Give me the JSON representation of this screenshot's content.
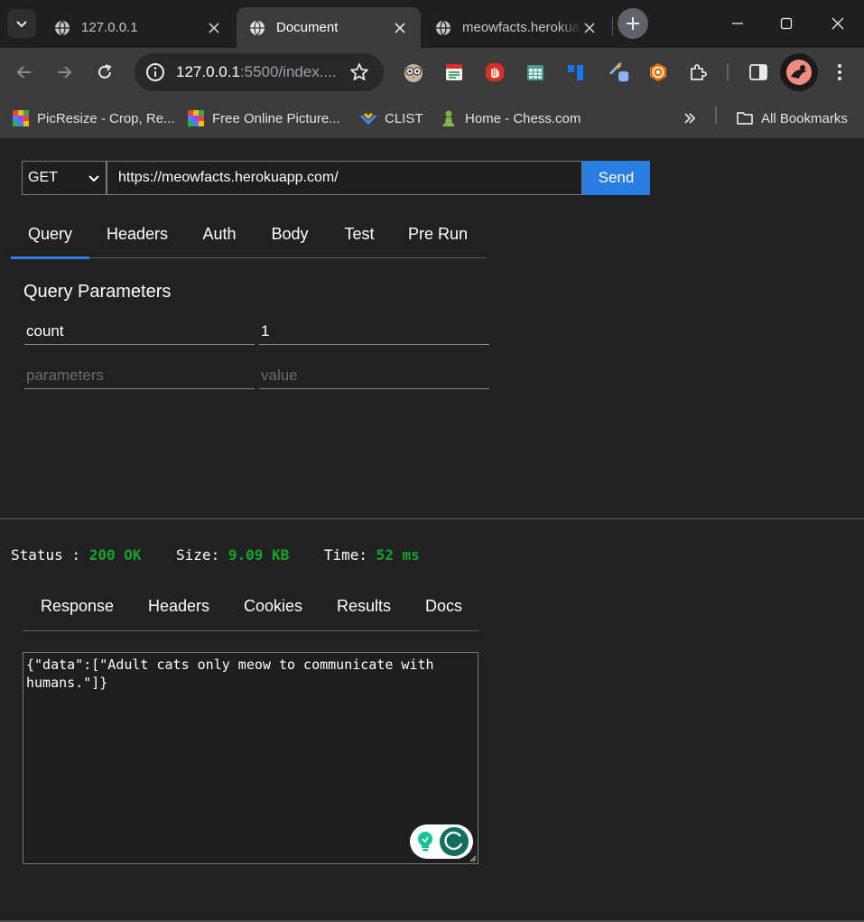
{
  "browser": {
    "tabs": [
      {
        "title": "127.0.0.1",
        "active": false
      },
      {
        "title": "Document",
        "active": true
      },
      {
        "title": "meowfacts.herokuapp.com",
        "active": false
      }
    ],
    "address": {
      "host": "127.0.0.1",
      "rest": ":5500/index...."
    },
    "bookmarks": [
      {
        "label": "PicResize - Crop, Re..."
      },
      {
        "label": "Free Online Picture..."
      },
      {
        "label": "CLIST"
      },
      {
        "label": "Home - Chess.com"
      }
    ],
    "all_bookmarks_label": "All Bookmarks"
  },
  "request": {
    "method": "GET",
    "url": "https://meowfacts.herokuapp.com/",
    "send_label": "Send",
    "tabs": [
      "Query",
      "Headers",
      "Auth",
      "Body",
      "Test",
      "Pre Run"
    ],
    "active_tab": "Query"
  },
  "query": {
    "title": "Query Parameters",
    "rows": [
      {
        "key": "count",
        "value": "1"
      }
    ],
    "key_placeholder": "parameters",
    "value_placeholder": "value"
  },
  "response": {
    "status_label": "Status :",
    "status_value": "200 OK",
    "size_label": "Size:",
    "size_value": "9.09 KB",
    "time_label": "Time:",
    "time_value": "52 ms",
    "tabs": [
      "Response",
      "Headers",
      "Cookies",
      "Results",
      "Docs"
    ],
    "body": "{\"data\":[\"Adult cats only meow to communicate with humans.\"]}"
  },
  "colors": {
    "accent": "#2a7de1",
    "status_ok": "#15a32c",
    "background": "#212121"
  }
}
